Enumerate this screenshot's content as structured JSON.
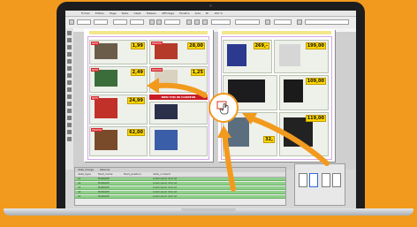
{
  "app": {
    "menu_items": [
      "Fichier",
      "Édition",
      "Page",
      "Texte",
      "Objet",
      "Tableau",
      "Affichage",
      "Fenêtre",
      "Aide",
      "Br",
      "100 %"
    ]
  },
  "colors": {
    "background": "#f29a1e",
    "accent_orange": "#f29a1e",
    "row_green": "#8fd08a",
    "price_yellow": "#ffd800",
    "promo_red": "#c91c24"
  },
  "layout_panel": {
    "tabs": [
      "data_merge",
      "liaisons"
    ],
    "headers": [
      "data_type",
      "field_name",
      "field_position",
      "data_content"
    ],
    "rows": [
      {
        "cells": [
          "A1",
          "MANAGER",
          "",
          "Lorem ipsum dolor sit"
        ]
      },
      {
        "cells": [
          "A2",
          "MANAGER",
          "",
          "Lorem ipsum dolor sit"
        ]
      },
      {
        "cells": [
          "A3",
          "MANAGER",
          "",
          "Lorem ipsum dolor sit"
        ]
      },
      {
        "cells": [
          "A4",
          "MANAGER",
          "",
          "Lorem ipsum dolor sit"
        ]
      },
      {
        "cells": [
          "A5",
          "MANAGER",
          "",
          "Lorem ipsum dolor sit"
        ]
      }
    ]
  },
  "catalog": {
    "left_page": {
      "tiles": [
        {
          "price": "1,99",
          "label": "NEW"
        },
        {
          "price": "28,00",
          "label": "PROMO"
        },
        {
          "price": "2,49",
          "label": "NEW"
        },
        {
          "price": "1,25",
          "label": "PROMO"
        },
        {
          "price": "24,99",
          "label": "NEW"
        },
        {
          "price": "62,00",
          "label": "PROMO"
        }
      ],
      "banner": "BIEN TAM 88 COUKEUR"
    },
    "right_page": {
      "tiles": [
        {
          "price": "269,-",
          "label": ""
        },
        {
          "price": "199,00",
          "label": ""
        },
        {
          "price": "109,00",
          "label": ""
        },
        {
          "price": "32,",
          "label": ""
        },
        {
          "price": "119,00",
          "label": ""
        }
      ]
    },
    "overlay_icon": "hand-pointer-icon"
  },
  "pages_panel": {
    "pages": [
      "1",
      "2",
      "3",
      "4"
    ]
  }
}
